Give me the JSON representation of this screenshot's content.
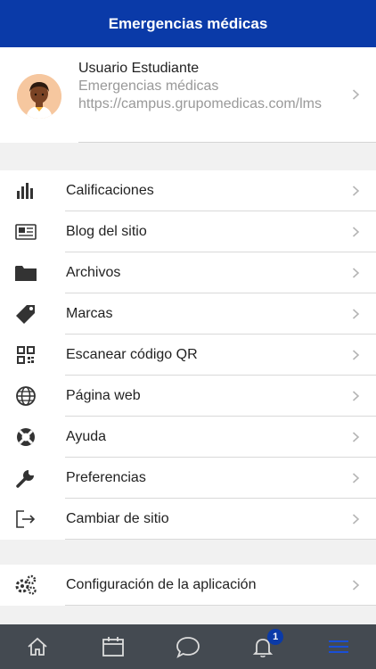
{
  "header": {
    "title": "Emergencias médicas"
  },
  "profile": {
    "name": "Usuario Estudiante",
    "site": "Emergencias médicas",
    "url": "https://campus.grupomedicas.com/lms"
  },
  "menu": [
    {
      "label": "Calificaciones",
      "icon": "bar-chart-icon"
    },
    {
      "label": "Blog del sitio",
      "icon": "newspaper-icon"
    },
    {
      "label": "Archivos",
      "icon": "folder-icon"
    },
    {
      "label": "Marcas",
      "icon": "tag-icon"
    },
    {
      "label": "Escanear código QR",
      "icon": "qr-code-icon"
    },
    {
      "label": "Página web",
      "icon": "globe-icon"
    },
    {
      "label": "Ayuda",
      "icon": "lifebuoy-icon"
    },
    {
      "label": "Preferencias",
      "icon": "wrench-icon"
    },
    {
      "label": "Cambiar de sitio",
      "icon": "sign-out-icon"
    }
  ],
  "menu2": [
    {
      "label": "Configuración de la aplicación",
      "icon": "cogs-icon"
    }
  ],
  "tabbar": {
    "notification_count": "1"
  },
  "colors": {
    "brand": "#0a3aa8",
    "tabbar": "#444a51"
  }
}
